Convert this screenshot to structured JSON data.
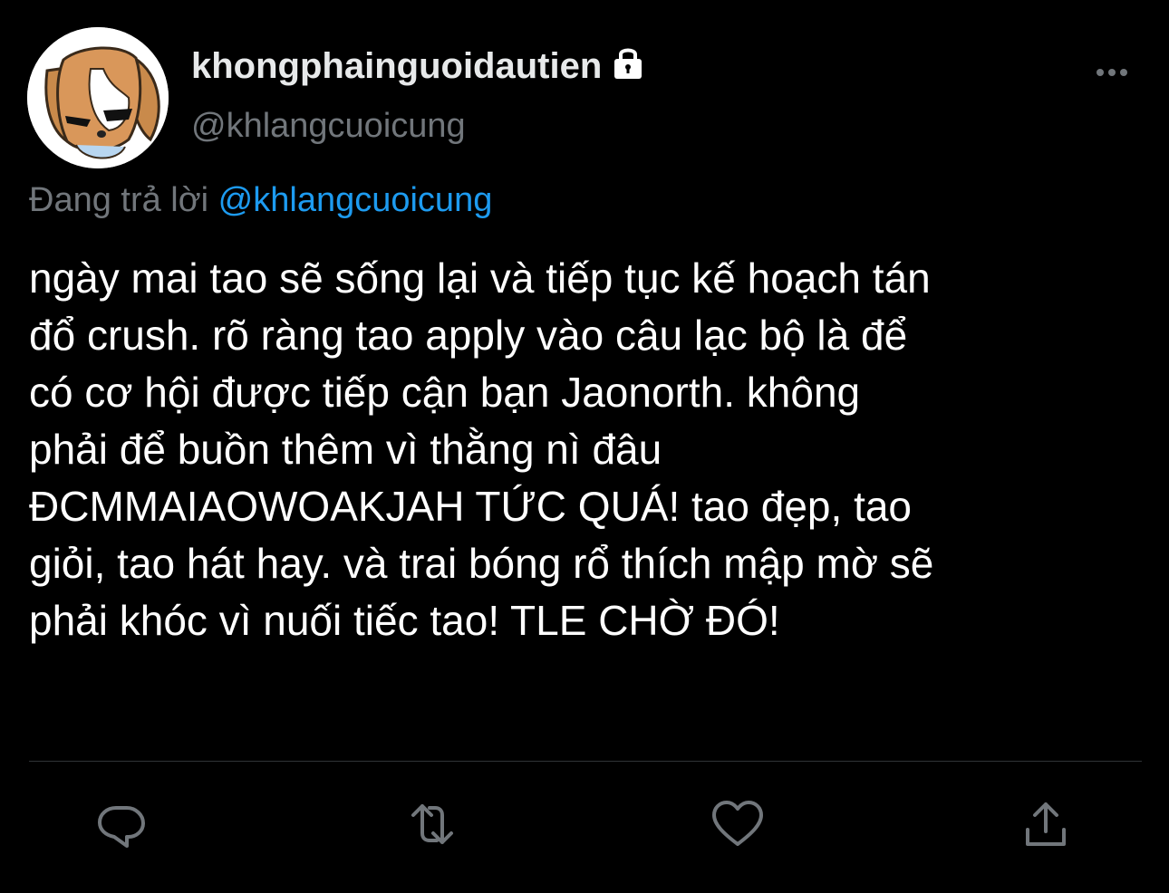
{
  "user": {
    "display_name": "khongphainguoidautien",
    "handle": "@khlangcuoicung",
    "protected_icon": "lock-icon",
    "avatar_icon": "cartoon-dog-avatar"
  },
  "reply": {
    "prefix": "Đang trả lời",
    "mention": "@khlangcuoicung"
  },
  "tweet": {
    "text": "ngày mai tao sẽ sống lại và tiếp tục kế hoạch tán\nđổ crush. rõ ràng tao apply vào câu lạc bộ là để\ncó cơ hội được tiếp cận bạn Jaonorth. không\nphải để buồn thêm vì thằng nì đâu\nĐCMMAIAOWOAKJAH TỨC QUÁ! tao đẹp, tao\ngiỏi, tao hát hay. và trai bóng rổ thích mập mờ sẽ\nphải khóc vì nuối tiếc tao! TLE CHỜ ĐÓ!"
  },
  "actions": [
    {
      "name": "reply",
      "icon": "reply-icon"
    },
    {
      "name": "retweet",
      "icon": "retweet-icon"
    },
    {
      "name": "like",
      "icon": "heart-icon"
    },
    {
      "name": "share",
      "icon": "share-icon"
    }
  ],
  "colors": {
    "background": "#000000",
    "text": "#ffffff",
    "muted": "#71767b",
    "link": "#1d9bf0",
    "divider": "#2f3336"
  }
}
